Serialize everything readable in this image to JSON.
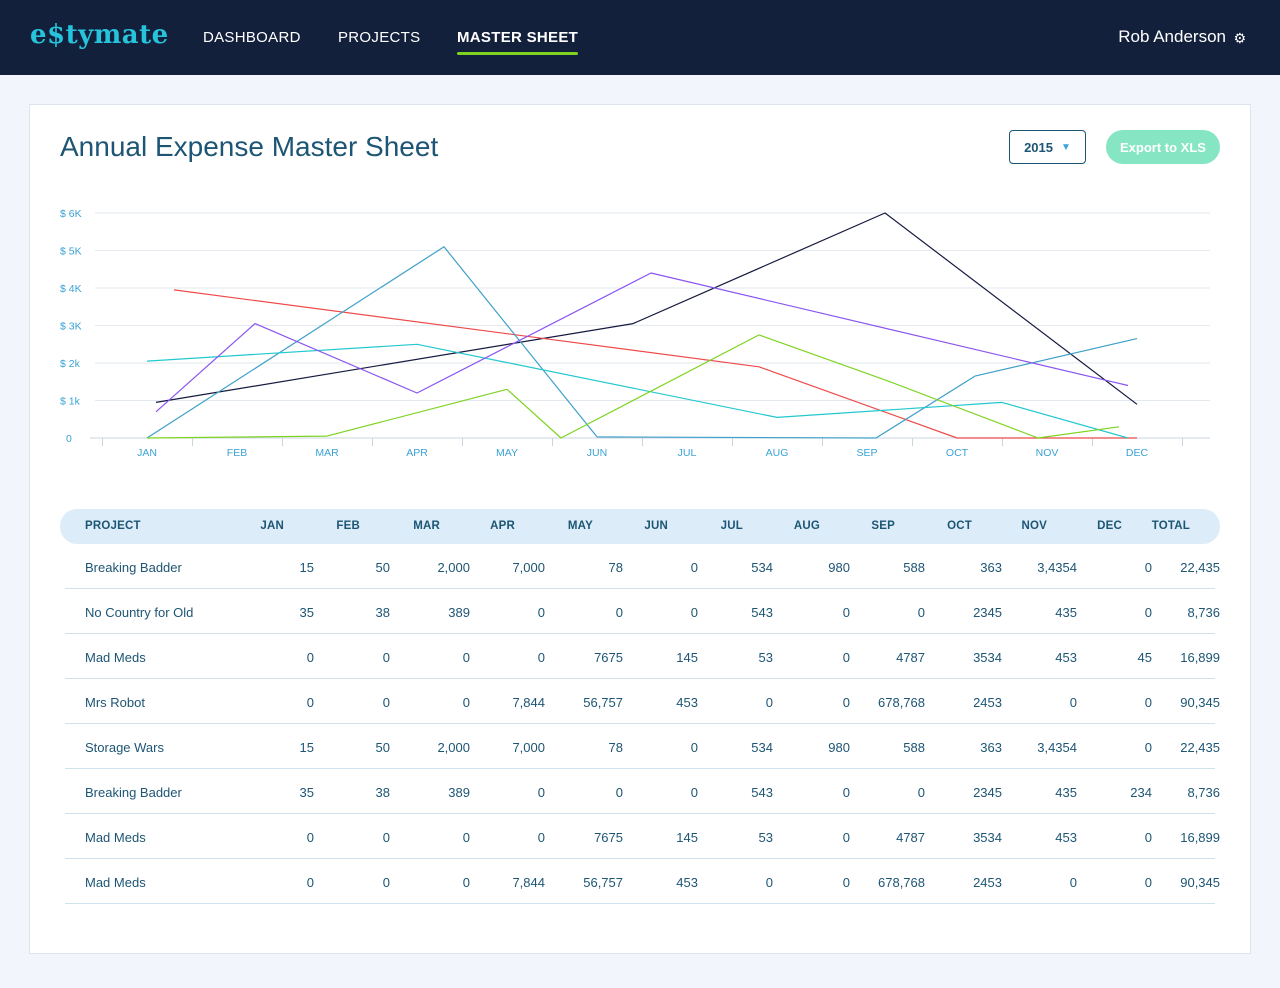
{
  "nav": {
    "logo": "e$tymate",
    "items": [
      "DASHBOARD",
      "PROJECTS",
      "MASTER SHEET"
    ],
    "active": "MASTER SHEET",
    "user_name": "Rob Anderson",
    "settings_icon": "gear-icon"
  },
  "page": {
    "title": "Annual Expense Master Sheet",
    "year": "2015",
    "export_label": "Export to XLS"
  },
  "colors": {
    "accent": "#27c3db",
    "nav_bg": "#13203c",
    "active_underline": "#7ed321",
    "export_button": "#86e6c4"
  },
  "chart_data": {
    "type": "line",
    "categories": [
      "JAN",
      "FEB",
      "MAR",
      "APR",
      "MAY",
      "JUN",
      "JUL",
      "AUG",
      "SEP",
      "OCT",
      "NOV",
      "DEC"
    ],
    "y_tick_labels": [
      "0",
      "$ 1k",
      "$ 2k",
      "$ 3K",
      "$ 4K",
      "$ 5K",
      "$ 6K"
    ],
    "ylim": [
      0,
      6000
    ],
    "grid": true,
    "series": [
      {
        "color": "#151a3f",
        "points": [
          [
            0.1,
            950
          ],
          [
            5.4,
            3050
          ],
          [
            8.2,
            6000
          ],
          [
            11.0,
            900
          ]
        ]
      },
      {
        "color": "#ee4b4b",
        "points": [
          [
            0.3,
            3950
          ],
          [
            6.8,
            1900
          ],
          [
            9.0,
            0
          ],
          [
            11.0,
            0
          ]
        ]
      },
      {
        "color": "#3fa0c9",
        "points": [
          [
            0.0,
            0
          ],
          [
            3.3,
            5100
          ],
          [
            5.0,
            30
          ],
          [
            8.1,
            0
          ],
          [
            9.2,
            1650
          ],
          [
            11.0,
            2650
          ]
        ]
      },
      {
        "color": "#22c8cf",
        "points": [
          [
            0.0,
            2050
          ],
          [
            3.0,
            2500
          ],
          [
            7.0,
            550
          ],
          [
            9.5,
            950
          ],
          [
            10.9,
            0
          ]
        ]
      },
      {
        "color": "#8a55f0",
        "points": [
          [
            0.1,
            700
          ],
          [
            1.2,
            3050
          ],
          [
            3.0,
            1200
          ],
          [
            5.6,
            4400
          ],
          [
            10.9,
            1400
          ]
        ]
      },
      {
        "color": "#7ed321",
        "points": [
          [
            0.0,
            0
          ],
          [
            2.0,
            50
          ],
          [
            4.0,
            1300
          ],
          [
            4.6,
            0
          ],
          [
            6.8,
            2750
          ],
          [
            8.2,
            1550
          ],
          [
            9.9,
            0
          ],
          [
            10.8,
            300
          ]
        ]
      }
    ]
  },
  "table": {
    "headers": [
      "PROJECT",
      "JAN",
      "FEB",
      "MAR",
      "APR",
      "MAY",
      "JUN",
      "JUL",
      "AUG",
      "SEP",
      "OCT",
      "NOV",
      "DEC",
      "TOTAL"
    ],
    "rows": [
      [
        "Breaking Badder",
        "15",
        "50",
        "2,000",
        "7,000",
        "78",
        "0",
        "534",
        "980",
        "588",
        "363",
        "3,4354",
        "0",
        "22,435"
      ],
      [
        "No Country for Old",
        "35",
        "38",
        "389",
        "0",
        "0",
        "0",
        "543",
        "0",
        "0",
        "2345",
        "435",
        "0",
        "8,736"
      ],
      [
        "Mad Meds",
        "0",
        "0",
        "0",
        "0",
        "7675",
        "145",
        "53",
        "0",
        "4787",
        "3534",
        "453",
        "45",
        "16,899"
      ],
      [
        "Mrs Robot",
        "0",
        "0",
        "0",
        "7,844",
        "56,757",
        "453",
        "0",
        "0",
        "678,768",
        "2453",
        "0",
        "0",
        "90,345"
      ],
      [
        "Storage Wars",
        "15",
        "50",
        "2,000",
        "7,000",
        "78",
        "0",
        "534",
        "980",
        "588",
        "363",
        "3,4354",
        "0",
        "22,435"
      ],
      [
        "Breaking Badder",
        "35",
        "38",
        "389",
        "0",
        "0",
        "0",
        "543",
        "0",
        "0",
        "2345",
        "435",
        "234",
        "8,736"
      ],
      [
        "Mad Meds",
        "0",
        "0",
        "0",
        "0",
        "7675",
        "145",
        "53",
        "0",
        "4787",
        "3534",
        "453",
        "0",
        "16,899"
      ],
      [
        "Mad Meds",
        "0",
        "0",
        "0",
        "7,844",
        "56,757",
        "453",
        "0",
        "0",
        "678,768",
        "2453",
        "0",
        "0",
        "90,345"
      ]
    ]
  }
}
